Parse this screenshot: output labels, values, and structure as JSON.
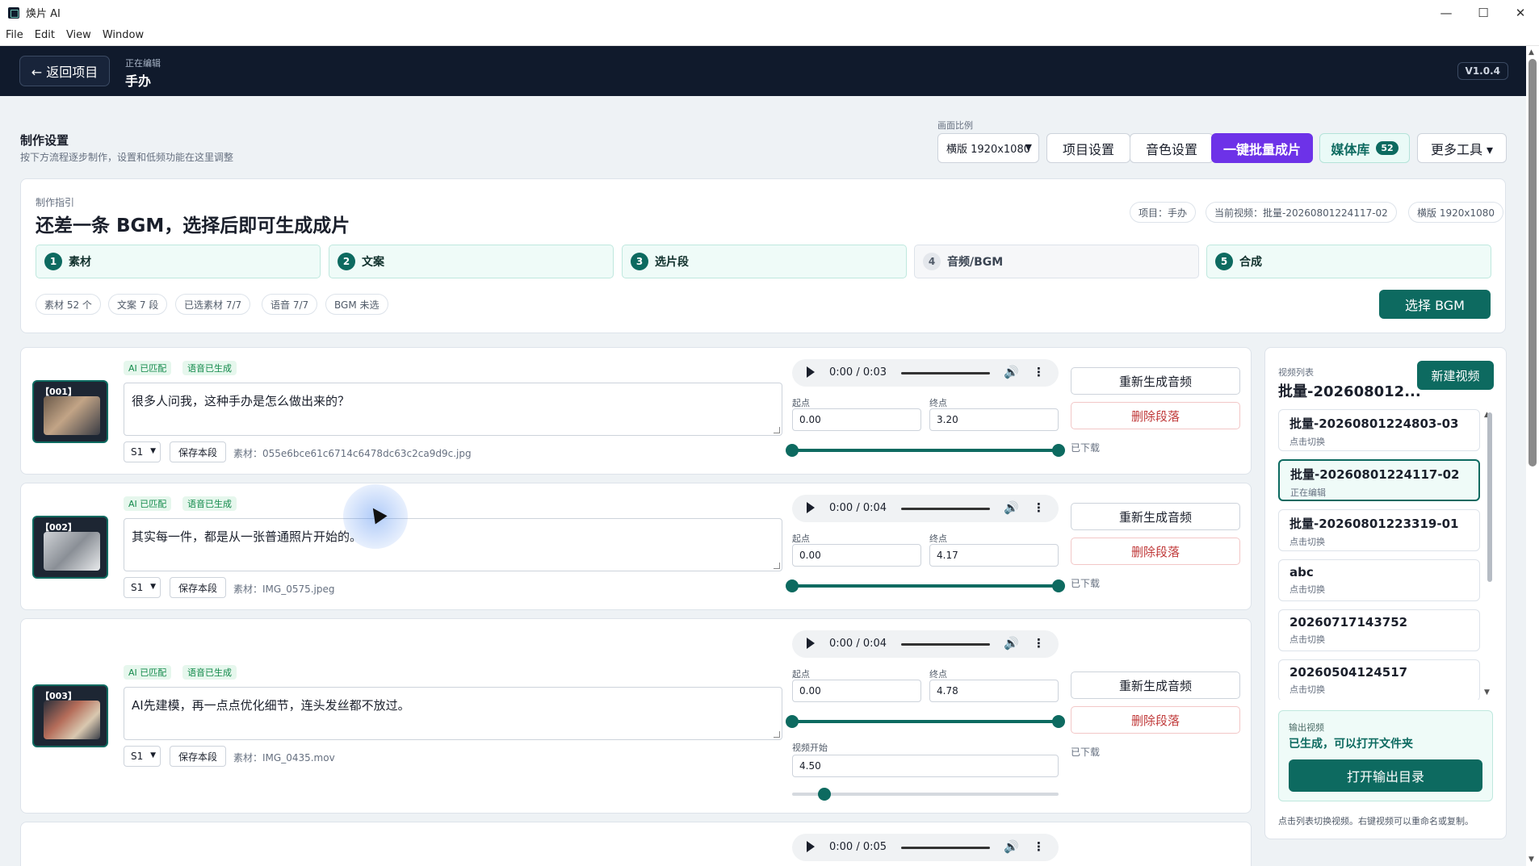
{
  "window": {
    "title": "焕片 AI",
    "controls": [
      "—",
      "☐",
      "✕"
    ]
  },
  "menu": [
    "File",
    "Edit",
    "View",
    "Window"
  ],
  "header": {
    "back_label": "← 返回项目",
    "editing_label": "正在编辑",
    "project_name": "手办",
    "version": "V1.0.4"
  },
  "settings": {
    "title": "制作设置",
    "subtitle": "按下方流程逐步制作，设置和低频功能在这里调整",
    "ratio_label": "画面比例",
    "ratio_value": "横版 1920x1080",
    "project_settings": "项目设置",
    "voice_settings": "音色设置",
    "batch_generate": "一键批量成片",
    "media_library": "媒体库",
    "media_count": "52",
    "more_tools": "更多工具 ▾"
  },
  "guide": {
    "label": "制作指引",
    "headline": "还差一条 BGM，选择后即可生成成片",
    "meta": [
      "项目：手办",
      "当前视频：批量-20260801224117-02",
      "横版 1920x1080"
    ],
    "steps": [
      {
        "num": "1",
        "label": "素材",
        "done": true
      },
      {
        "num": "2",
        "label": "文案",
        "done": true
      },
      {
        "num": "3",
        "label": "选片段",
        "done": true
      },
      {
        "num": "4",
        "label": "音频/BGM",
        "done": false
      },
      {
        "num": "5",
        "label": "合成",
        "done": true
      }
    ],
    "stats": [
      "素材 52 个",
      "文案 7 段",
      "已选素材 7/7",
      "语音 7/7",
      "BGM 未选"
    ],
    "select_bgm": "选择 BGM"
  },
  "segment_ui": {
    "tag_ai": "AI 已匹配",
    "tag_voice": "语音已生成",
    "voice_option": "S1",
    "save_label": "保存本段",
    "start_label": "起点",
    "end_label": "终点",
    "regen_label": "重新生成音频",
    "delete_label": "删除段落",
    "downloaded_label": "已下载",
    "video_start_label": "视频开始"
  },
  "segments": [
    {
      "id": "【001】",
      "text": "很多人问我，这种手办是怎么做出来的？",
      "asset": "素材：055e6bce61c6714c6478dc63c2ca9d9c.jpg",
      "time": "0:00 / 0:03",
      "start": "0.00",
      "end": "3.20"
    },
    {
      "id": "【002】",
      "text": "其实每一件，都是从一张普通照片开始的。",
      "asset": "素材：IMG_0575.jpeg",
      "time": "0:00 / 0:04",
      "start": "0.00",
      "end": "4.17"
    },
    {
      "id": "【003】",
      "text": "AI先建模，再一点点优化细节，连头发丝都不放过。",
      "asset": "素材：IMG_0435.mov",
      "time": "0:00 / 0:04",
      "start": "0.00",
      "end": "4.78",
      "video_start": "4.50"
    },
    {
      "time": "0:00 / 0:05"
    }
  ],
  "right_panel": {
    "label": "视频列表",
    "title": "批量-202608012...",
    "new_video": "新建视频",
    "videos": [
      {
        "name": "批量-20260801224803-03",
        "hint": "点击切换",
        "active": false
      },
      {
        "name": "批量-20260801224117-02",
        "hint": "正在编辑",
        "active": true
      },
      {
        "name": "批量-20260801223319-01",
        "hint": "点击切换",
        "active": false
      },
      {
        "name": "abc",
        "hint": "点击切换",
        "active": false
      },
      {
        "name": "20260717143752",
        "hint": "点击切换",
        "active": false
      },
      {
        "name": "20260504124517",
        "hint": "点击切换",
        "active": false
      }
    ],
    "output_label": "输出视频",
    "output_status": "已生成，可以打开文件夹",
    "open_dir": "打开输出目录",
    "footer": "点击列表切换视频。右键视频可以重命名或复制。"
  }
}
